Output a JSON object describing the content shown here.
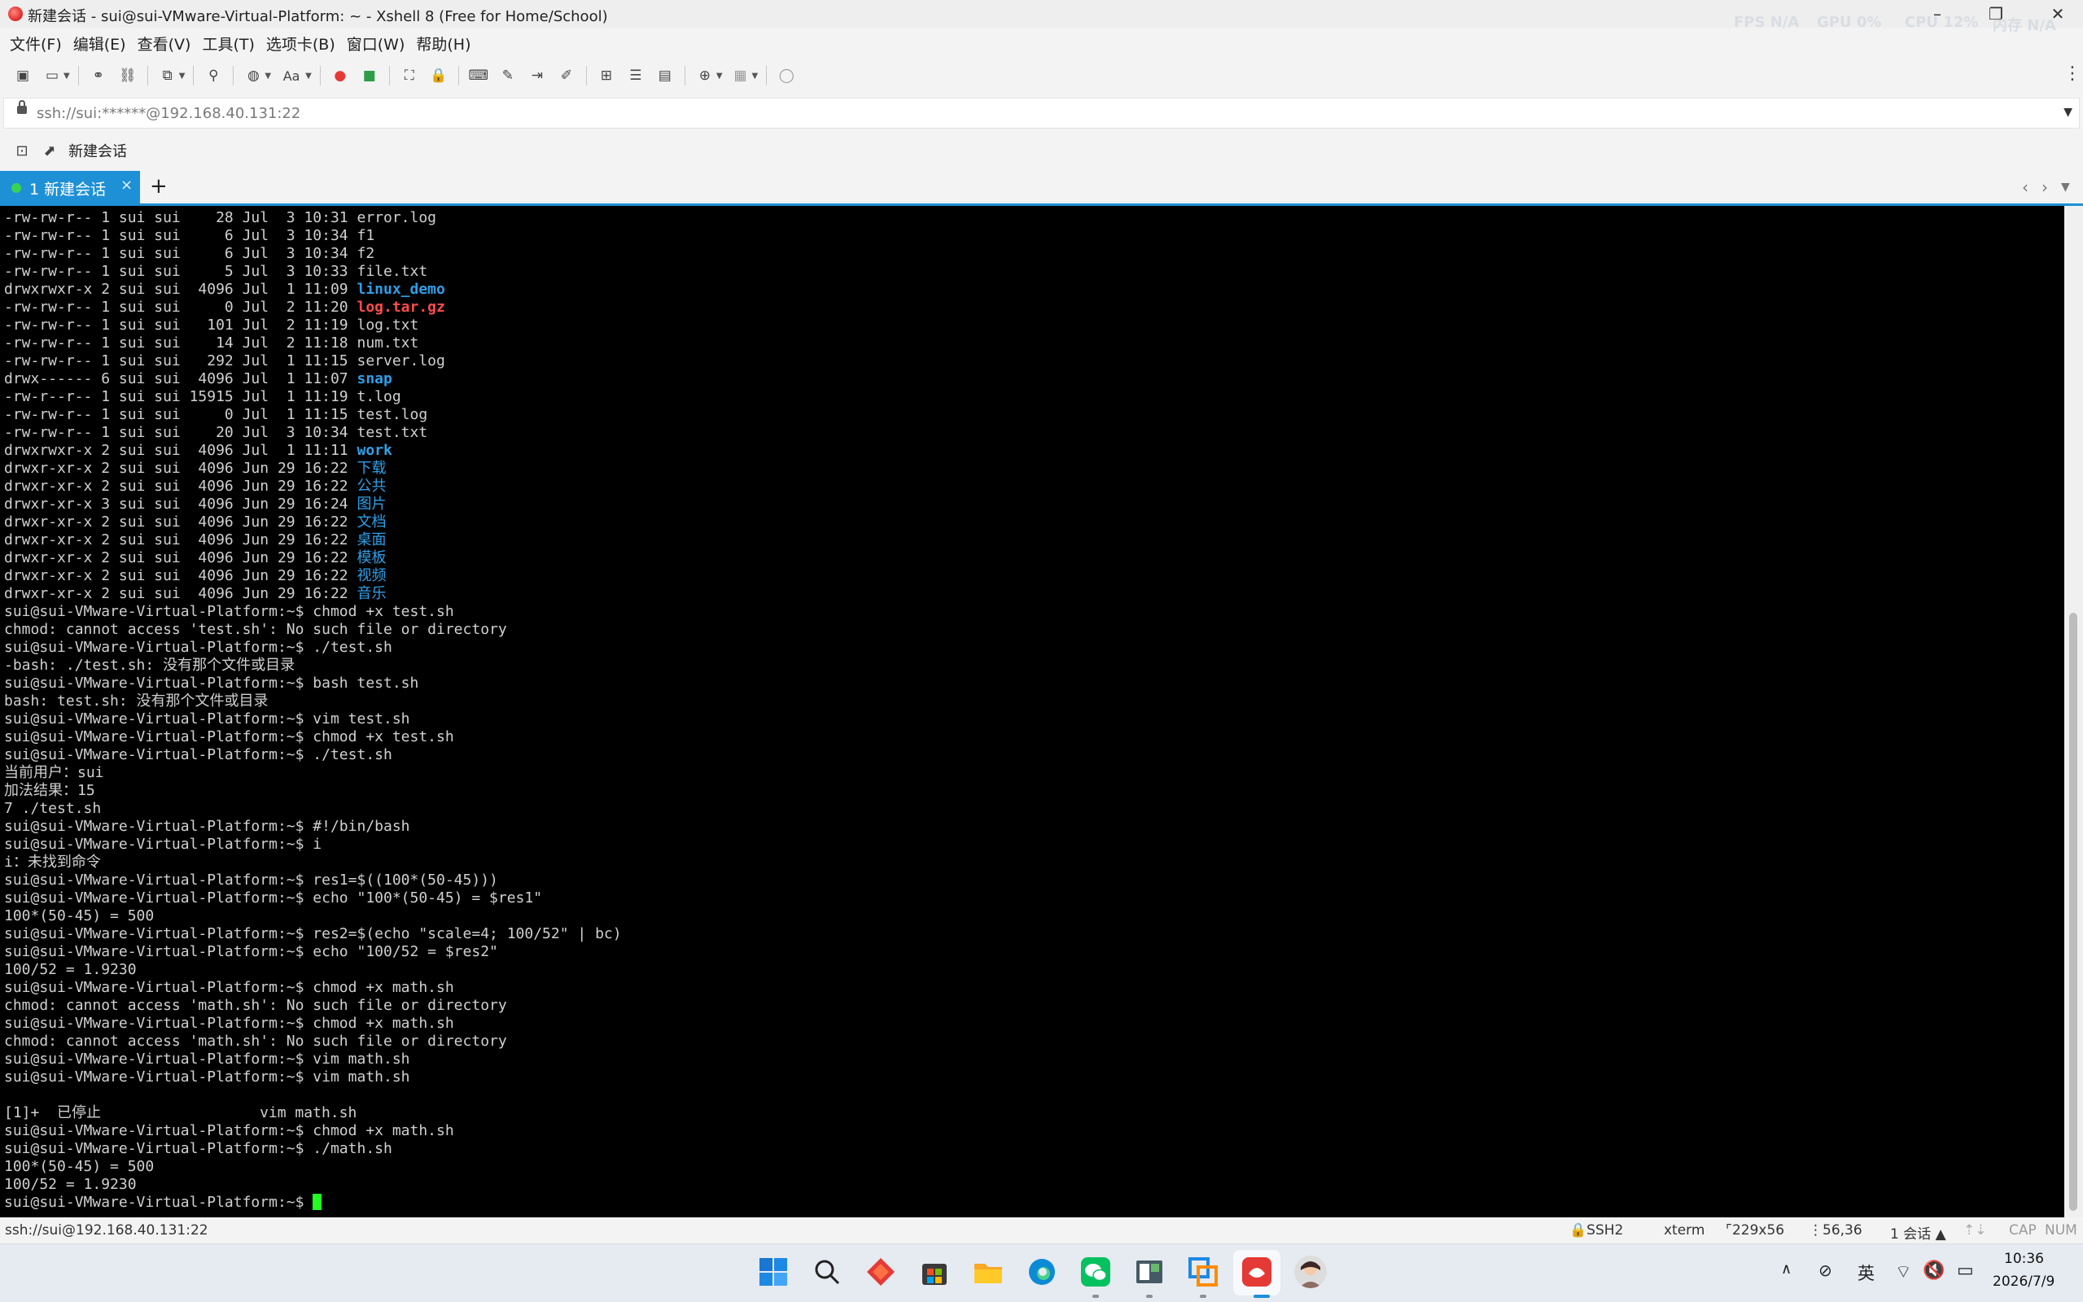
{
  "window": {
    "title": "新建会话 - sui@sui-VMware-Virtual-Platform: ~ - Xshell 8 (Free for Home/School)",
    "perf": {
      "fps_label": "FPS",
      "fps_value": "N/A",
      "gpu_label": "GPU",
      "gpu_value": "0%",
      "cpu_label": "CPU",
      "cpu_value": "12%",
      "mem_label": "内存",
      "mem_value": "N/A"
    }
  },
  "menu": [
    "文件(F)",
    "编辑(E)",
    "查看(V)",
    "工具(T)",
    "选项卡(B)",
    "窗口(W)",
    "帮助(H)"
  ],
  "address": {
    "text": "ssh://sui:******@192.168.40.131:22"
  },
  "quickbar": {
    "new_session_label": "新建会话"
  },
  "tabs": [
    {
      "label": "1 新建会话",
      "close": "×"
    }
  ],
  "terminal": {
    "lines": [
      {
        "p": "-rw-rw-r-- 1 sui sui    28 Jul  3 10:31 ",
        "n": "error.log",
        "t": ""
      },
      {
        "p": "-rw-rw-r-- 1 sui sui     6 Jul  3 10:34 ",
        "n": "f1",
        "t": ""
      },
      {
        "p": "-rw-rw-r-- 1 sui sui     6 Jul  3 10:34 ",
        "n": "f2",
        "t": ""
      },
      {
        "p": "-rw-rw-r-- 1 sui sui     5 Jul  3 10:33 ",
        "n": "file.txt",
        "t": ""
      },
      {
        "p": "drwxrwxr-x 2 sui sui  4096 Jul  1 11:09 ",
        "n": "linux_demo",
        "t": "dir"
      },
      {
        "p": "-rw-rw-r-- 1 sui sui     0 Jul  2 11:20 ",
        "n": "log.tar.gz",
        "t": "arch"
      },
      {
        "p": "-rw-rw-r-- 1 sui sui   101 Jul  2 11:19 ",
        "n": "log.txt",
        "t": ""
      },
      {
        "p": "-rw-rw-r-- 1 sui sui    14 Jul  2 11:18 ",
        "n": "num.txt",
        "t": ""
      },
      {
        "p": "-rw-rw-r-- 1 sui sui   292 Jul  1 11:15 ",
        "n": "server.log",
        "t": ""
      },
      {
        "p": "drwx------ 6 sui sui  4096 Jul  1 11:07 ",
        "n": "snap",
        "t": "dir"
      },
      {
        "p": "-rw-r--r-- 1 sui sui 15915 Jul  1 11:19 ",
        "n": "t.log",
        "t": ""
      },
      {
        "p": "-rw-rw-r-- 1 sui sui     0 Jul  1 11:15 ",
        "n": "test.log",
        "t": ""
      },
      {
        "p": "-rw-rw-r-- 1 sui sui    20 Jul  3 10:34 ",
        "n": "test.txt",
        "t": ""
      },
      {
        "p": "drwxrwxr-x 2 sui sui  4096 Jul  1 11:11 ",
        "n": "work",
        "t": "dir"
      },
      {
        "p": "drwxr-xr-x 2 sui sui  4096 Jun 29 16:22 ",
        "n": "下载",
        "t": "cjk"
      },
      {
        "p": "drwxr-xr-x 2 sui sui  4096 Jun 29 16:22 ",
        "n": "公共",
        "t": "cjk"
      },
      {
        "p": "drwxr-xr-x 3 sui sui  4096 Jun 29 16:24 ",
        "n": "图片",
        "t": "cjk"
      },
      {
        "p": "drwxr-xr-x 2 sui sui  4096 Jun 29 16:22 ",
        "n": "文档",
        "t": "cjk"
      },
      {
        "p": "drwxr-xr-x 2 sui sui  4096 Jun 29 16:22 ",
        "n": "桌面",
        "t": "cjk"
      },
      {
        "p": "drwxr-xr-x 2 sui sui  4096 Jun 29 16:22 ",
        "n": "模板",
        "t": "cjk"
      },
      {
        "p": "drwxr-xr-x 2 sui sui  4096 Jun 29 16:22 ",
        "n": "视频",
        "t": "cjk"
      },
      {
        "p": "drwxr-xr-x 2 sui sui  4096 Jun 29 16:22 ",
        "n": "音乐",
        "t": "cjk"
      },
      {
        "p": "sui@sui-VMware-Virtual-Platform:~$ chmod +x test.sh",
        "n": "",
        "t": ""
      },
      {
        "p": "chmod: cannot access 'test.sh': No such file or directory",
        "n": "",
        "t": ""
      },
      {
        "p": "sui@sui-VMware-Virtual-Platform:~$ ./test.sh",
        "n": "",
        "t": ""
      },
      {
        "p": "-bash: ./test.sh: 没有那个文件或目录",
        "n": "",
        "t": ""
      },
      {
        "p": "sui@sui-VMware-Virtual-Platform:~$ bash test.sh",
        "n": "",
        "t": ""
      },
      {
        "p": "bash: test.sh: 没有那个文件或目录",
        "n": "",
        "t": ""
      },
      {
        "p": "sui@sui-VMware-Virtual-Platform:~$ vim test.sh",
        "n": "",
        "t": ""
      },
      {
        "p": "sui@sui-VMware-Virtual-Platform:~$ chmod +x test.sh",
        "n": "",
        "t": ""
      },
      {
        "p": "sui@sui-VMware-Virtual-Platform:~$ ./test.sh",
        "n": "",
        "t": ""
      },
      {
        "p": "当前用户：sui",
        "n": "",
        "t": ""
      },
      {
        "p": "加法结果：15",
        "n": "",
        "t": ""
      },
      {
        "p": "7 ./test.sh",
        "n": "",
        "t": ""
      },
      {
        "p": "sui@sui-VMware-Virtual-Platform:~$ #!/bin/bash",
        "n": "",
        "t": ""
      },
      {
        "p": "sui@sui-VMware-Virtual-Platform:~$ i",
        "n": "",
        "t": ""
      },
      {
        "p": "i：未找到命令",
        "n": "",
        "t": ""
      },
      {
        "p": "sui@sui-VMware-Virtual-Platform:~$ res1=$((100*(50-45)))",
        "n": "",
        "t": ""
      },
      {
        "p": "sui@sui-VMware-Virtual-Platform:~$ echo \"100*(50-45) = $res1\"",
        "n": "",
        "t": ""
      },
      {
        "p": "100*(50-45) = 500",
        "n": "",
        "t": ""
      },
      {
        "p": "sui@sui-VMware-Virtual-Platform:~$ res2=$(echo \"scale=4; 100/52\" | bc)",
        "n": "",
        "t": ""
      },
      {
        "p": "sui@sui-VMware-Virtual-Platform:~$ echo \"100/52 = $res2\"",
        "n": "",
        "t": ""
      },
      {
        "p": "100/52 = 1.9230",
        "n": "",
        "t": ""
      },
      {
        "p": "sui@sui-VMware-Virtual-Platform:~$ chmod +x math.sh",
        "n": "",
        "t": ""
      },
      {
        "p": "chmod: cannot access 'math.sh': No such file or directory",
        "n": "",
        "t": ""
      },
      {
        "p": "sui@sui-VMware-Virtual-Platform:~$ chmod +x math.sh",
        "n": "",
        "t": ""
      },
      {
        "p": "chmod: cannot access 'math.sh': No such file or directory",
        "n": "",
        "t": ""
      },
      {
        "p": "sui@sui-VMware-Virtual-Platform:~$ vim math.sh",
        "n": "",
        "t": ""
      },
      {
        "p": "sui@sui-VMware-Virtual-Platform:~$ vim math.sh",
        "n": "",
        "t": ""
      },
      {
        "p": "",
        "n": "",
        "t": ""
      },
      {
        "p": "[1]+  已停止                  vim math.sh",
        "n": "",
        "t": ""
      },
      {
        "p": "sui@sui-VMware-Virtual-Platform:~$ chmod +x math.sh",
        "n": "",
        "t": ""
      },
      {
        "p": "sui@sui-VMware-Virtual-Platform:~$ ./math.sh",
        "n": "",
        "t": ""
      },
      {
        "p": "100*(50-45) = 500",
        "n": "",
        "t": ""
      },
      {
        "p": "100/52 = 1.9230",
        "n": "",
        "t": ""
      }
    ],
    "prompt": "sui@sui-VMware-Virtual-Platform:~$ "
  },
  "status": {
    "connection": "ssh://sui@192.168.40.131:22",
    "protocol": "SSH2",
    "term": "xterm",
    "size": "229x56",
    "cursor": "56,36",
    "sessions": "1 会话",
    "cap": "CAP",
    "num": "NUM"
  },
  "taskbar": {
    "ime": "英",
    "time": "10:36",
    "date": "2026/7/9"
  },
  "colors": {
    "accent": "#1e90d6",
    "term_bg": "#000000",
    "dir": "#2f9fe8",
    "archive": "#ff4c4c",
    "cursor": "#22ff22"
  }
}
